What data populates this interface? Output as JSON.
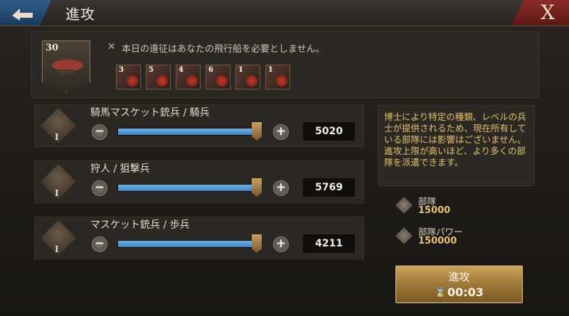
{
  "header": {
    "title": "進攻",
    "close_glyph": "X"
  },
  "ship": {
    "level": "30",
    "message": "本日の遠征はあなたの飛行船を必要としません。",
    "units": [
      {
        "count": "3"
      },
      {
        "count": "5"
      },
      {
        "count": "4"
      },
      {
        "count": "6"
      },
      {
        "count": "1"
      },
      {
        "count": "1"
      }
    ]
  },
  "troops": [
    {
      "name": "騎馬マスケット銃兵 / 騎兵",
      "tier": "I",
      "count": "5020",
      "fill": 0.98
    },
    {
      "name": "狩人 / 狙撃兵",
      "tier": "I",
      "count": "5769",
      "fill": 0.98
    },
    {
      "name": "マスケット銃兵 / 歩兵",
      "tier": "I",
      "count": "4211",
      "fill": 0.98
    }
  ],
  "info": {
    "text": "博士により特定の種類、レベルの兵士が提供されるため、現在所有している部隊には影響はございません。進攻上限が高いほど、より多くの部隊を派遣できます。"
  },
  "stats": [
    {
      "label": "部隊",
      "value": "15000",
      "icon": "troop-helmet-icon"
    },
    {
      "label": "部隊パワー",
      "value": "150000",
      "icon": "crossed-swords-icon"
    }
  ],
  "march": {
    "label": "進攻",
    "time": "00:03"
  },
  "colors": {
    "accent_gold": "#e6c36a",
    "slider_blue": "#4a90d0",
    "close_red": "#8a2b27"
  }
}
